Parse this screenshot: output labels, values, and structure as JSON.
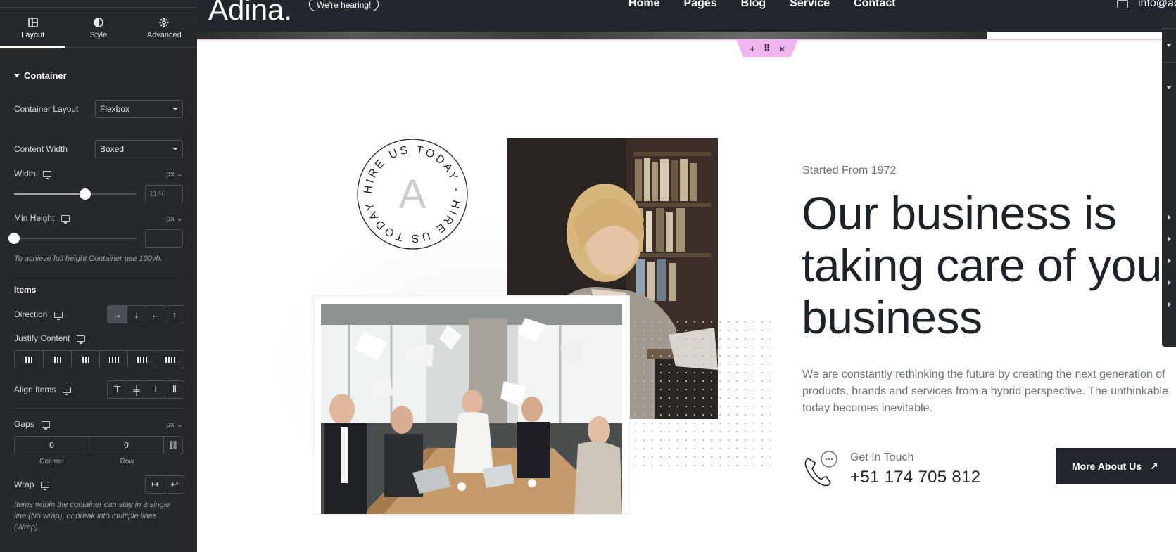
{
  "panel": {
    "tabs": [
      {
        "label": "Layout",
        "icon": "layout-icon",
        "active": true
      },
      {
        "label": "Style",
        "icon": "style-icon",
        "active": false
      },
      {
        "label": "Advanced",
        "icon": "gear-icon",
        "active": false
      }
    ],
    "section_title": "Container",
    "container_layout": {
      "label": "Container Layout",
      "value": "Flexbox"
    },
    "content_width": {
      "label": "Content Width",
      "value": "Boxed"
    },
    "width": {
      "label": "Width",
      "unit": "px",
      "placeholder": "1140",
      "slider_fraction": 0.58
    },
    "min_height": {
      "label": "Min Height",
      "unit": "px",
      "value": "",
      "slider_fraction": 0
    },
    "min_height_hint": "To achieve full height Container use 100vh.",
    "items_heading": "Items",
    "direction": {
      "label": "Direction",
      "options": [
        "→",
        "↓",
        "←",
        "↑"
      ],
      "selected": 0
    },
    "justify_content": {
      "label": "Justify Content"
    },
    "align_items": {
      "label": "Align Items"
    },
    "gaps": {
      "label": "Gaps",
      "unit": "px",
      "column_value": "0",
      "row_value": "0",
      "column_label": "Column",
      "row_label": "Row"
    },
    "wrap": {
      "label": "Wrap"
    },
    "wrap_hint": "Items within the container can stay in a single line (No wrap), or break into multiple lines (Wrap)."
  },
  "site": {
    "logo": "Adina.",
    "badge_pill": "We're hearing!",
    "nav": [
      "Home",
      "Pages",
      "Blog",
      "Service",
      "Contact"
    ],
    "email": "info@ad",
    "circle_badge": {
      "text": "HIRE US TODAY - HIRE US TODAY - ",
      "letter": "A"
    },
    "started": "Started From 1972",
    "title_lines": [
      "Our business is",
      "taking care of you",
      "business"
    ],
    "description": "We are constantly rethinking the future by creating the next generation of products, brands and services from a hybrid perspective. The unthinkable today becomes inevitable.",
    "contact_label": "Get In Touch",
    "contact_phone": "+51 174 705 812",
    "cta_label": "More About Us"
  },
  "colors": {
    "panel_bg": "#26292c",
    "dark": "#21272d",
    "accent_pink": "#f1b5ef",
    "muted_text": "#6b7178"
  }
}
